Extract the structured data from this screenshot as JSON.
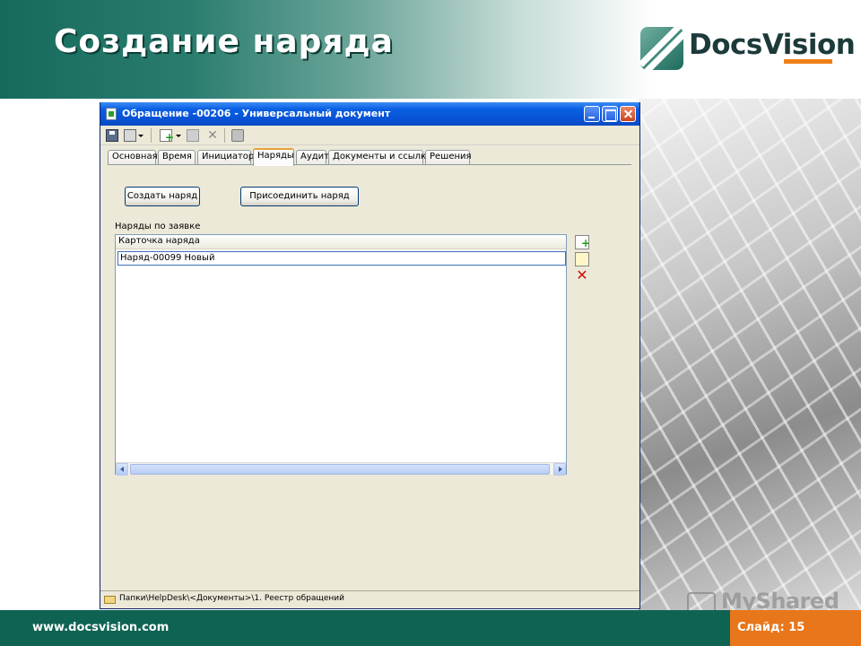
{
  "slide": {
    "title": "Создание наряда",
    "logo_text": "DocsVision",
    "footer_url": "www.docsvision.com",
    "footer_slide": "Слайд: 15",
    "watermark": "MyShared"
  },
  "window": {
    "title": "Обращение -00206 - Универсальный документ"
  },
  "tabs": [
    {
      "label": "Основная"
    },
    {
      "label": "Время"
    },
    {
      "label": "Инициатор"
    },
    {
      "label": "Наряды"
    },
    {
      "label": "Аудит"
    },
    {
      "label": "Документы и ссылки"
    },
    {
      "label": "Решения"
    }
  ],
  "active_tab": "Наряды",
  "actions": {
    "create_label": "Создать наряд",
    "attach_label": "Присоединить наряд"
  },
  "orders": {
    "group_label": "Наряды по заявке",
    "column_header": "Карточка наряда",
    "rows": [
      "Наряд-00099 Новый"
    ]
  },
  "statusbar": {
    "path": "Папки\\HelpDesk\\<Документы>\\1. Реестр обращений"
  },
  "icons": {
    "window": "document-icon",
    "save": "save-icon",
    "copy": "copy-icon",
    "new": "new-document-icon",
    "edit": "edit-icon",
    "delete": "delete-icon",
    "print": "print-icon",
    "folder": "folder-icon"
  },
  "colors": {
    "header_green": "#166a5c",
    "footer_green": "#0f6353",
    "footer_orange": "#e8761b",
    "xp_titlebar": "#0752d6"
  }
}
